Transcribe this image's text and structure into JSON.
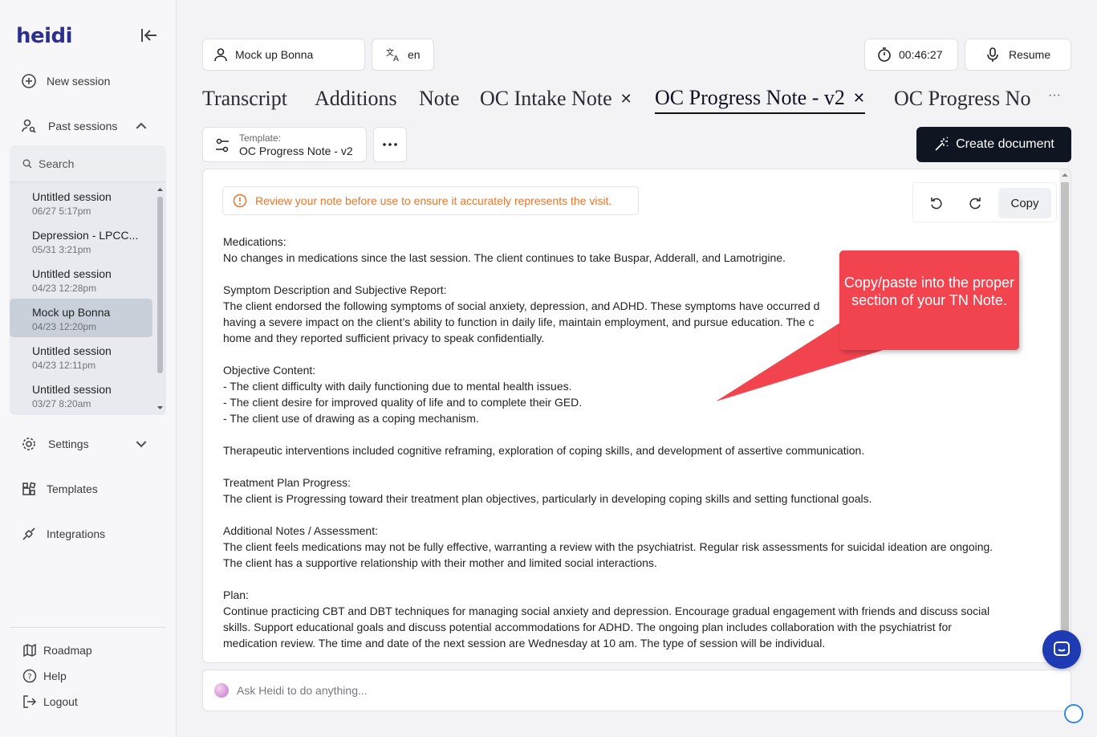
{
  "app": {
    "logo": "heidi"
  },
  "sidebar": {
    "new_session": "New session",
    "past_sessions": "Past sessions",
    "search_placeholder": "Search",
    "sessions": [
      {
        "title": "Untitled session",
        "date": "06/27 5:17pm",
        "active": false
      },
      {
        "title": "Depression - LPCC...",
        "date": "05/31 3:21pm",
        "active": false
      },
      {
        "title": "Untitled session",
        "date": "04/23 12:28pm",
        "active": false
      },
      {
        "title": "Mock up Bonna",
        "date": "04/23 12:20pm",
        "active": true
      },
      {
        "title": "Untitled session",
        "date": "04/23 12:11pm",
        "active": false
      },
      {
        "title": "Untitled session",
        "date": "03/27 8:20am",
        "active": false
      }
    ],
    "settings": "Settings",
    "templates": "Templates",
    "integrations": "Integrations",
    "roadmap": "Roadmap",
    "help": "Help",
    "logout": "Logout"
  },
  "topbar": {
    "patient": "Mock up Bonna",
    "language": "en",
    "timer": "00:46:27",
    "resume": "Resume"
  },
  "tabs": [
    {
      "label": "Transcript",
      "closable": false
    },
    {
      "label": "Additions",
      "closable": false
    },
    {
      "label": "Note",
      "closable": false
    },
    {
      "label": "OC Intake Note",
      "closable": true
    },
    {
      "label": "OC Progress Note - v2",
      "closable": true,
      "active": true
    },
    {
      "label": "OC Progress No",
      "closable": false
    }
  ],
  "tabs_more": "···",
  "template": {
    "label": "Template:",
    "value": "OC Progress Note - v2"
  },
  "create_document": "Create document",
  "warning": "Review your note before use to ensure it accurately represents the visit.",
  "copy": "Copy",
  "note": [
    "Medications:",
    "No changes in medications since the last session. The client continues to take Buspar, Adderall, and Lamotrigine.",
    "",
    "Symptom Description and Subjective Report:",
    "The client endorsed the following symptoms of social anxiety, depression, and ADHD. These symptoms have occurred d",
    "having a severe impact on the client’s ability to function in daily life, maintain employment, and pursue education. The c                                                        t",
    "home and they reported sufficient privacy to speak confidentially.",
    "",
    "Objective Content:",
    "- The client difficulty with daily functioning due to mental health issues.",
    "- The client desire for improved quality of life and to complete their GED.",
    "- The client use of drawing as a coping mechanism.",
    "",
    "Therapeutic interventions included cognitive reframing, exploration of coping skills, and development of assertive communication.",
    "",
    "Treatment Plan Progress:",
    "The client is Progressing toward their treatment plan objectives, particularly in developing coping skills and setting functional goals.",
    "",
    "Additional Notes / Assessment:",
    "The client feels medications may not be fully effective, warranting a review with the psychiatrist. Regular risk assessments for suicidal ideation are ongoing.",
    "The client has a supportive relationship with their mother and limited social interactions.",
    "",
    "Plan:",
    "Continue practicing CBT and DBT techniques for managing social anxiety and depression. Encourage gradual engagement with friends and discuss social",
    "skills. Support educational goals and discuss potential accommodations for ADHD. The ongoing plan includes collaboration with the psychiatrist for",
    "medication review. The time and date of the next session are Wednesday at 10 am. The type of session will be individual."
  ],
  "callout": "Copy/paste into the proper section of your TN Note.",
  "ask_placeholder": "Ask Heidi to do anything...",
  "colors": {
    "brand": "#2c2f8f",
    "warning": "#e8762b",
    "callout": "#f2444f",
    "primary_button": "#101522"
  }
}
